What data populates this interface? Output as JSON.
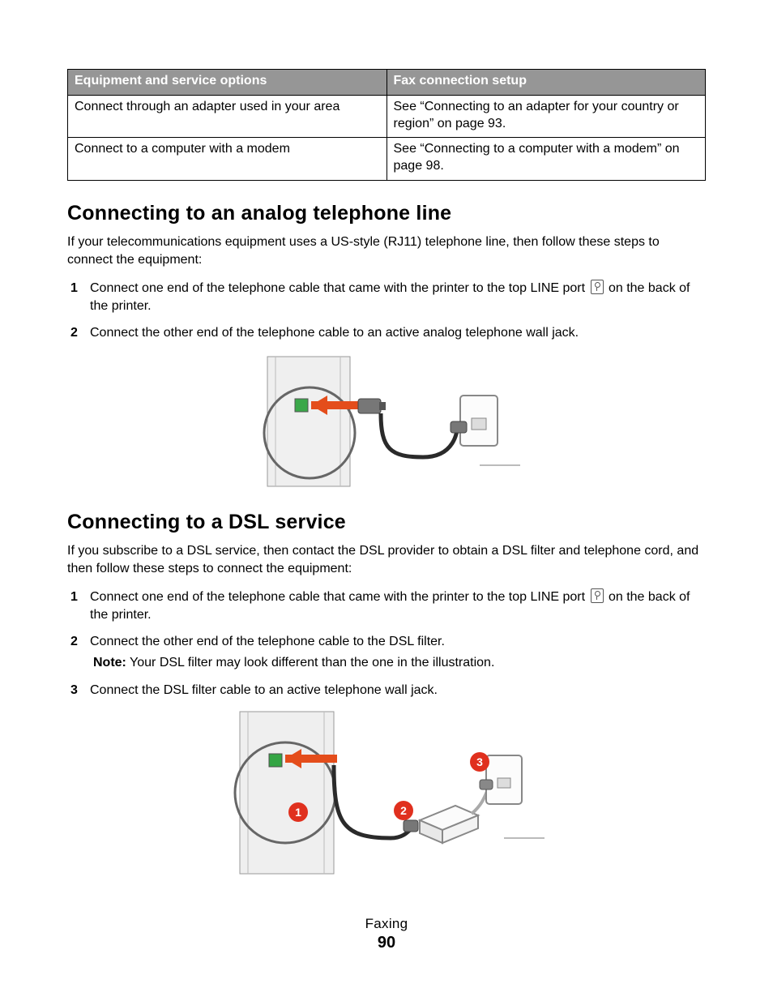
{
  "table": {
    "header_left": "Equipment and service options",
    "header_right": "Fax connection setup",
    "rows": [
      {
        "left": "Connect through an adapter used in your area",
        "right": "See “Connecting to an adapter for your country or region” on page 93."
      },
      {
        "left": "Connect to a computer with a modem",
        "right": "See “Connecting to a computer with a modem” on page 98."
      }
    ]
  },
  "section_a": {
    "heading": "Connecting to an analog telephone line",
    "intro": "If your telecommunications equipment uses a US-style (RJ11) telephone line, then follow these steps to connect the equipment:",
    "step1_pre": "Connect one end of the telephone cable that came with the printer to the top LINE port ",
    "step1_post": " on the back of the printer.",
    "step2": "Connect the other end of the telephone cable to an active analog telephone wall jack."
  },
  "section_b": {
    "heading": "Connecting to a DSL service",
    "intro": "If you subscribe to a DSL service, then contact the DSL provider to obtain a DSL filter and telephone cord, and then follow these steps to connect the equipment:",
    "step1_pre": "Connect one end of the telephone cable that came with the printer to the top LINE port ",
    "step1_post": " on the back of the printer.",
    "step2": "Connect the other end of the telephone cable to the DSL filter.",
    "note_label": "Note:",
    "note_body": " Your DSL filter may look different than the one in the illustration.",
    "step3": "Connect the DSL filter cable to an active telephone wall jack."
  },
  "footer": {
    "section": "Faxing",
    "page": "90"
  },
  "nums": {
    "n1": "1",
    "n2": "2",
    "n3": "3"
  }
}
